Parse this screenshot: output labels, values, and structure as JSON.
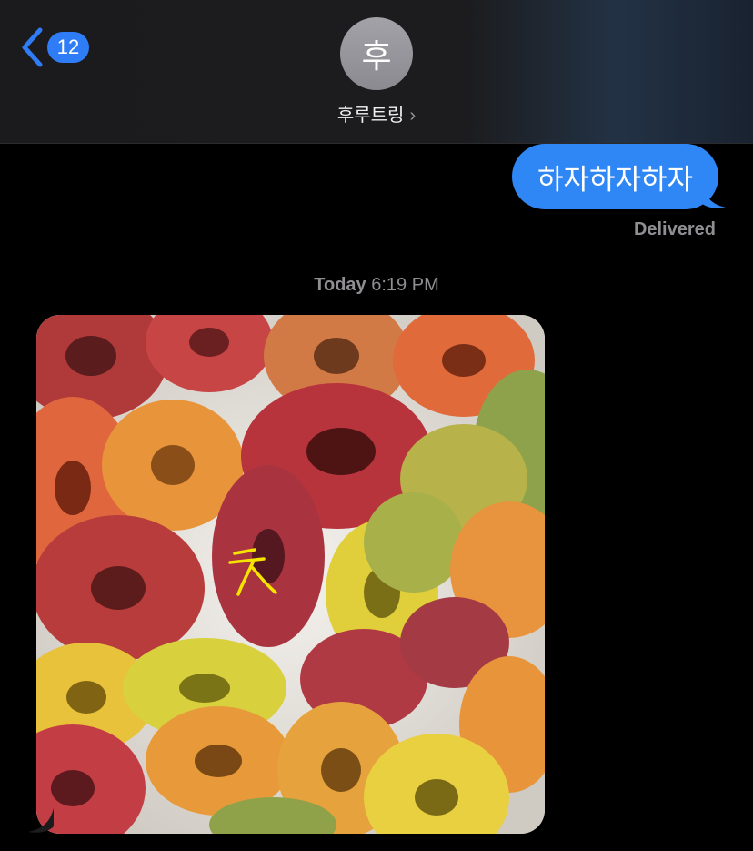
{
  "header": {
    "back_count": "12",
    "avatar_initial": "후",
    "contact_name": "후루트링"
  },
  "messages": {
    "outgoing_text": "하자하자하자",
    "delivered_label": "Delivered",
    "timestamp_day": "Today",
    "timestamp_time": "6:19 PM",
    "photo_annotation": "굿"
  },
  "colors": {
    "bubble_blue": "#2f86f5",
    "badge_blue": "#2f7df6",
    "secondary_text": "#8e8e93"
  }
}
